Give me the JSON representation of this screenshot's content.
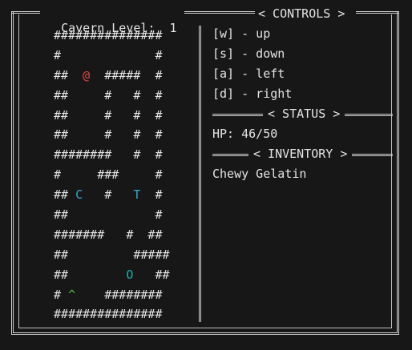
{
  "header": {
    "level_label": "Cavern Level:",
    "level_value": "1"
  },
  "controls": {
    "title": "< CONTROLS >",
    "items": [
      {
        "key": "[w]",
        "action": "- up"
      },
      {
        "key": "[s]",
        "action": "- down"
      },
      {
        "key": "[a]",
        "action": "- left"
      },
      {
        "key": "[d]",
        "action": "- right"
      }
    ]
  },
  "status": {
    "title": "< STATUS >",
    "hp_label": "HP:",
    "hp_value": "46/50"
  },
  "inventory": {
    "title": "< INVENTORY >",
    "items": [
      "Chewy Gelatin"
    ]
  },
  "map": {
    "rows": [
      "###############",
      "#             #",
      "##  @  #####  #",
      "##     #   #  #",
      "##     #   #  #",
      "##     #   #  #",
      "########   #  #",
      "#     ###     #",
      "## C   #   T  #",
      "##            #",
      "#######   #  ##",
      "##         #####",
      "##        O   ##",
      "# ^    ########",
      "###############"
    ],
    "glyph_colors": {
      "@": "#e04a4a",
      "C": "#3aa8c8",
      "T": "#3aa8c8",
      "O": "#1fb0a8",
      "^": "#4cc04c"
    }
  }
}
